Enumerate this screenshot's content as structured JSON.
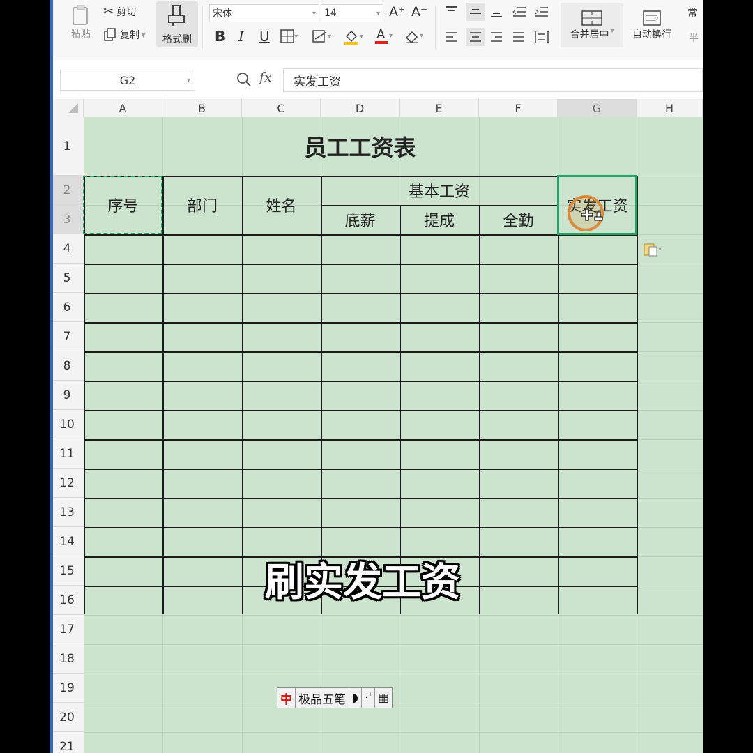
{
  "ribbon": {
    "paste_label": "粘贴",
    "cut_label": "剪切",
    "copy_label": "复制",
    "format_painter_label": "格式刷",
    "font_name": "宋体",
    "font_size": "14",
    "bold": "B",
    "italic": "I",
    "underline": "U",
    "merge_center_label": "合并居中",
    "wrap_label": "自动换行",
    "partial_right": "常",
    "partial_right2": "半"
  },
  "formula_bar": {
    "name_box": "G2",
    "fx": "fx",
    "content": "实发工资"
  },
  "columns": [
    "A",
    "B",
    "C",
    "D",
    "E",
    "F",
    "G",
    "H"
  ],
  "selected_column": "G",
  "rows": [
    "1",
    "2",
    "3",
    "4",
    "5",
    "6",
    "7",
    "8",
    "9",
    "10",
    "11",
    "12",
    "13",
    "14",
    "15",
    "16",
    "17",
    "18",
    "19",
    "20",
    "21"
  ],
  "table": {
    "title": "员工工资表",
    "headers": {
      "index": "序号",
      "department": "部门",
      "name": "姓名",
      "basic_salary": "基本工资",
      "base_pay": "底薪",
      "commission": "提成",
      "attendance": "全勤",
      "net_salary": "实发工资"
    }
  },
  "subtitle": "刷实发工资",
  "ime": {
    "logo": "中",
    "name": "极品五笔"
  },
  "colors": {
    "sheet_bg": "#cce3cd",
    "selection": "#21a366",
    "cursor_ring": "#d98a3a"
  }
}
